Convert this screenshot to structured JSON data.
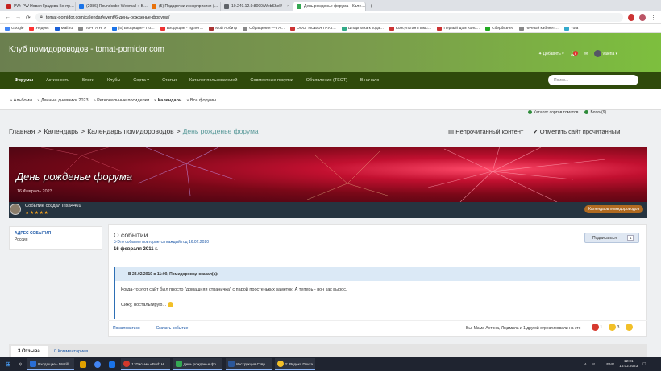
{
  "browser": {
    "tabs": [
      {
        "label": "PW: PW Новая Градова Контр…",
        "color": "#c5221f"
      },
      {
        "label": "(2986) Roundcube Webmail :: В…",
        "color": "#1a73e8"
      },
      {
        "label": "(5) Подарочки и сюрпризики (…",
        "color": "#e8710a"
      },
      {
        "label": "10.249.12.9:8090/WebShell/",
        "color": "#5f6368"
      },
      {
        "label": "День рожденье форума - Кале…",
        "color": "#34a853",
        "active": true
      }
    ],
    "new_tab": "+",
    "url": "tomat-pomidor.com/calendar/event/6-день-рожденье-форума/",
    "bookmarks": [
      "Google",
      "Яндекс",
      "Mail.ru",
      "ПОЧТА НГУ",
      "(5) Входящие - По…",
      "Входящие - ngtner…",
      "Мой Арбитр",
      "Обращения — ГА…",
      "ООО \"НОВАЯ ГРУЗ…",
      "Шпаргалка к кодa…",
      "КонсультантПлюс…",
      "Первый Дом Конс…",
      "Сбербизнес",
      "Личный кабинет…",
      "Yota"
    ]
  },
  "site": {
    "title": "Клуб помидороводов - tomat-pomidor.com",
    "add_label": "Добавить",
    "notif_count": "6",
    "username": "valeria",
    "nav": [
      "Форумы",
      "Активность",
      "Блоги",
      "Клубы",
      "Сорта",
      "Статьи",
      "Каталог пользователей",
      "Совместные покупки",
      "Объявления (ТЕСТ)",
      "В начало"
    ],
    "search_placeholder": "Поиск...",
    "subnav": [
      "» Альбомы",
      "» Дачные дневники 2023",
      "» Региональные посиделки",
      "» Календарь",
      "» Все форумы"
    ],
    "right_links": [
      "Каталог сортов томатов",
      "Блоги(9)"
    ],
    "breadcrumb": [
      "Главная",
      "Календарь",
      "Календарь помидороводов",
      "День рожденье форума"
    ],
    "unread": "Непрочитанный контент",
    "mark_read": "Отметить сайт прочитанным"
  },
  "event": {
    "title": "День рожденье форума",
    "date": "16 Февраль 2023",
    "creator": "Событие создал Irisa4469",
    "stars": "★★★★★",
    "calendar_badge": "Календарь помидороводов",
    "side_heading": "АДРЕС СОБЫТИЯ",
    "side_value": "Россия",
    "about": "О событии",
    "recurrence": "Это событие повторяется каждый год 16.02.2020",
    "when": "16 февраля 2011 г.",
    "subscribe": "Подписаться",
    "subscribe_count": "1",
    "quote_head": "В 23.02.2019 в 11:00, Помидоровод сказал(а):",
    "quote_text": "Когда-то этот сайт был просто \"домашняя страничка\" с парой простеньких заметок. А теперь - вон как вырос.",
    "quote_text2": "Сижу, ностальгирую...",
    "link_report": "Пожаловаться",
    "link_download": "Скачать событие",
    "liked": "Вы, Мама Антона, Людмила и 1 другой отреагировали на это",
    "reactions": [
      {
        "count": "1",
        "color": "#d63a2f"
      },
      {
        "count": "3",
        "color": "#f2c029"
      }
    ],
    "tab_reviews": "3 Отзыва",
    "tab_comments": "0 Комментариев"
  },
  "taskbar": {
    "apps": [
      {
        "label": "Входящие - Mozill…",
        "color": "#2a6ed6"
      },
      {
        "label": "",
        "color": "#e0a000"
      },
      {
        "label": "",
        "color": "#4285f4"
      },
      {
        "label": "",
        "color": "#1a73e8"
      },
      {
        "label": "1: Письмо «Fwd: Н…",
        "color": "#d2382b"
      },
      {
        "label": "День рожденье фо…",
        "color": "#34a853"
      },
      {
        "label": "Инструкция Сквр…",
        "color": "#2b579a"
      },
      {
        "label": "2: Яндекс Почта",
        "color": "#f2c029"
      }
    ],
    "lang": "ENG",
    "time": "12:01",
    "date": "16.02.2023"
  }
}
